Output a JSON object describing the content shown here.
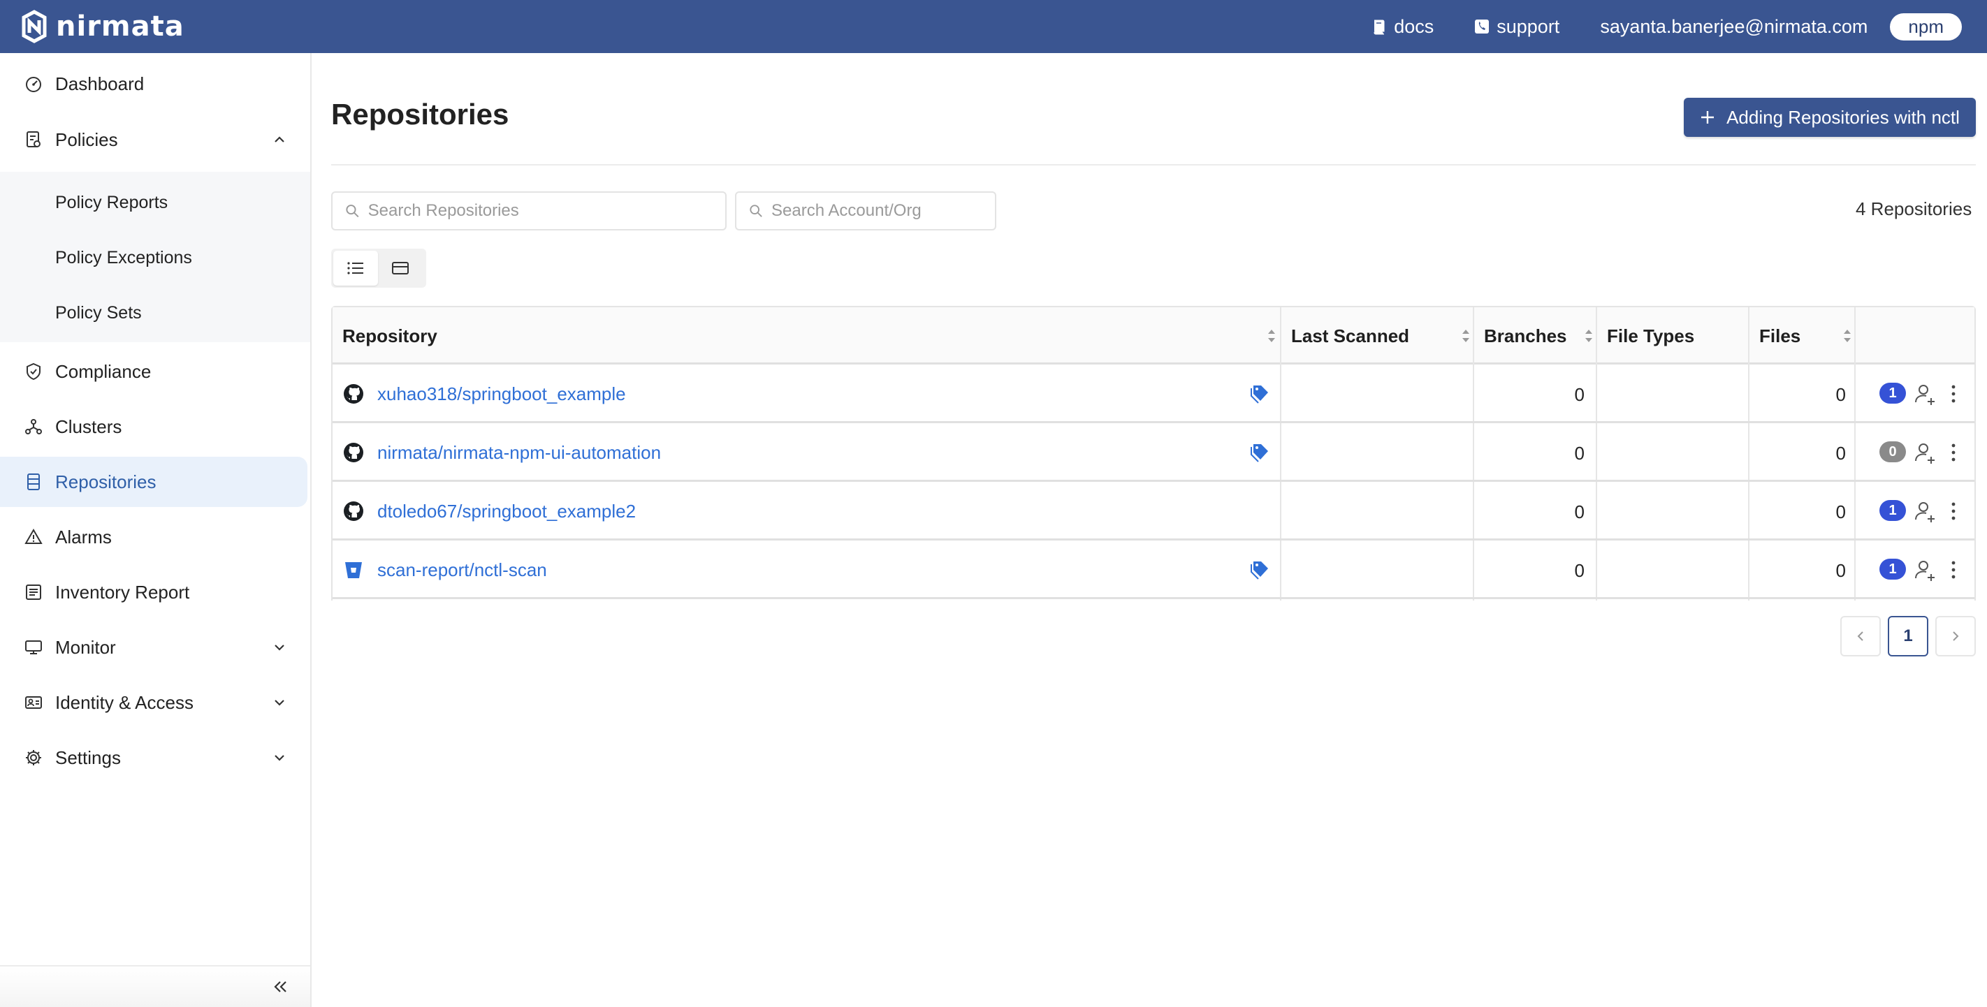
{
  "brand": {
    "name": "nirmata"
  },
  "topbar": {
    "docs_label": "docs",
    "support_label": "support",
    "user_email": "sayanta.banerjee@nirmata.com",
    "org_label": "npm"
  },
  "sidebar": {
    "dashboard": "Dashboard",
    "policies": "Policies",
    "policy_reports": "Policy Reports",
    "policy_exceptions": "Policy Exceptions",
    "policy_sets": "Policy Sets",
    "compliance": "Compliance",
    "clusters": "Clusters",
    "repositories": "Repositories",
    "alarms": "Alarms",
    "inventory_report": "Inventory Report",
    "monitor": "Monitor",
    "identity_access": "Identity & Access",
    "settings": "Settings"
  },
  "page": {
    "title": "Repositories",
    "add_button_label": "Adding Repositories with nctl",
    "search_repos_placeholder": "Search Repositories",
    "search_account_placeholder": "Search Account/Org",
    "repo_count": "4 Repositories"
  },
  "table": {
    "columns": {
      "repository": "Repository",
      "last_scanned": "Last Scanned",
      "branches": "Branches",
      "file_types": "File Types",
      "files": "Files"
    },
    "rows": [
      {
        "name": "xuhao318/springboot_example",
        "provider": "github",
        "tagged": true,
        "last_scanned": "",
        "branches": "0",
        "file_types": "",
        "files": "0",
        "badge": "1"
      },
      {
        "name": "nirmata/nirmata-npm-ui-automation",
        "provider": "github",
        "tagged": true,
        "last_scanned": "",
        "branches": "0",
        "file_types": "",
        "files": "0",
        "badge": "0"
      },
      {
        "name": "dtoledo67/springboot_example2",
        "provider": "github",
        "tagged": false,
        "last_scanned": "",
        "branches": "0",
        "file_types": "",
        "files": "0",
        "badge": "1"
      },
      {
        "name": "scan-report/nctl-scan",
        "provider": "bitbucket",
        "tagged": true,
        "last_scanned": "",
        "branches": "0",
        "file_types": "",
        "files": "0",
        "badge": "1"
      }
    ]
  },
  "pagination": {
    "current_page": "1"
  },
  "colors": {
    "topbar": "#3a5591",
    "link": "#2f6fd6",
    "badge_active": "#3552d6",
    "badge_zero": "#8a8a8a",
    "active_nav_bg": "#e9f1fb"
  }
}
